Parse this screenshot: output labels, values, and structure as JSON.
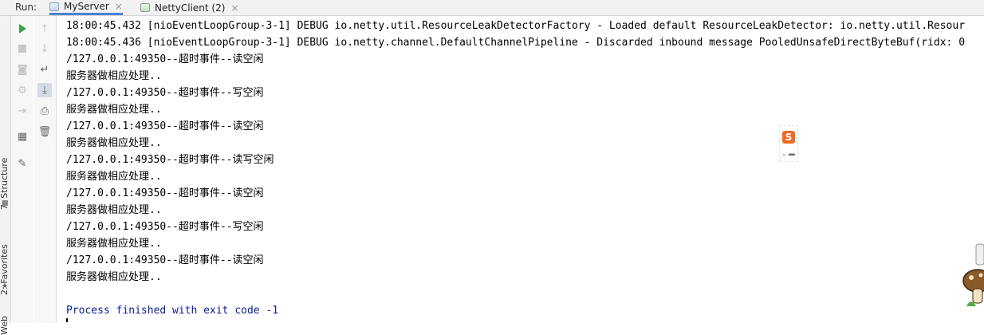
{
  "run_bar": {
    "label": "Run:",
    "tabs": [
      {
        "label": "MyServer",
        "close": "×",
        "active": true
      },
      {
        "label": "NettyClient (2)",
        "close": "×",
        "active": false
      }
    ]
  },
  "side_stripe": {
    "structure_label": "7: Structure",
    "favorites_label": "2: Favorites",
    "web_label": "Web"
  },
  "ime": {
    "badge": "S",
    "tools": "⌄ ▬"
  },
  "console": {
    "lines": [
      "18:00:45.432 [nioEventLoopGroup-3-1] DEBUG io.netty.util.ResourceLeakDetectorFactory - Loaded default ResourceLeakDetector: io.netty.util.Resour",
      "18:00:45.436 [nioEventLoopGroup-3-1] DEBUG io.netty.channel.DefaultChannelPipeline - Discarded inbound message PooledUnsafeDirectByteBuf(ridx: 0",
      "/127.0.0.1:49350--超时事件--读空闲",
      "服务器做相应处理..",
      "/127.0.0.1:49350--超时事件--写空闲",
      "服务器做相应处理..",
      "/127.0.0.1:49350--超时事件--读空闲",
      "服务器做相应处理..",
      "/127.0.0.1:49350--超时事件--读写空闲",
      "服务器做相应处理..",
      "/127.0.0.1:49350--超时事件--读空闲",
      "服务器做相应处理..",
      "/127.0.0.1:49350--超时事件--写空闲",
      "服务器做相应处理..",
      "/127.0.0.1:49350--超时事件--读空闲",
      "服务器做相应处理.."
    ],
    "finish_message": "Process finished with exit code -1"
  },
  "colors": {
    "run_green": "#3fa14a",
    "finish_blue": "#0b209a",
    "active_tab_underline": "#4a83d6"
  }
}
